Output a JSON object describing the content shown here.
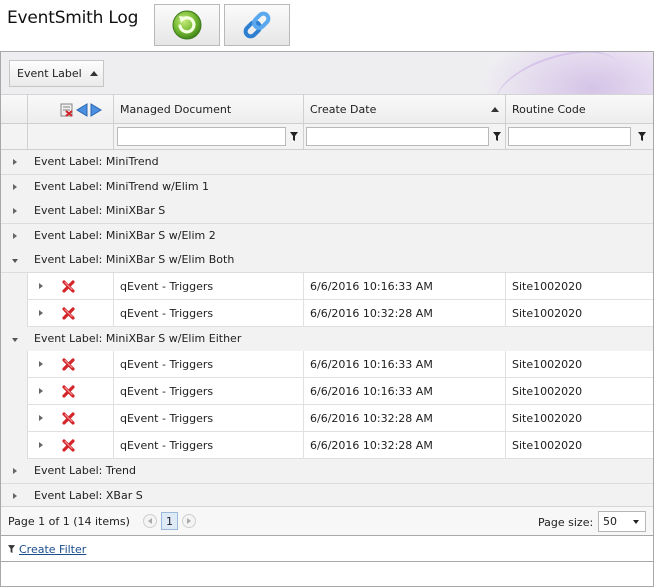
{
  "app": {
    "title": "EventSmith Log"
  },
  "toolbar": {
    "refresh_icon": "refresh-icon",
    "link_icon": "chain-link-icon"
  },
  "group_panel": {
    "chip_label": "Event Label",
    "chip_sort": "ascending"
  },
  "columns": [
    {
      "label": "Managed Document"
    },
    {
      "label": "Create Date",
      "sort": "ascending"
    },
    {
      "label": "Routine Code"
    }
  ],
  "header_icons": [
    "delete-icon",
    "previous-icon",
    "next-icon"
  ],
  "groups": [
    {
      "label": "Event Label: MiniTrend",
      "expanded": false,
      "rows": []
    },
    {
      "label": "Event Label: MiniTrend w/Elim 1",
      "expanded": false,
      "rows": []
    },
    {
      "label": "Event Label: MiniXBar S",
      "expanded": false,
      "rows": []
    },
    {
      "label": "Event Label: MiniXBar S w/Elim 2",
      "expanded": false,
      "rows": []
    },
    {
      "label": "Event Label: MiniXBar S w/Elim Both",
      "expanded": true,
      "rows": [
        {
          "document": "qEvent - Triggers",
          "date": "6/6/2016 10:16:33 AM",
          "routine": "Site1002020"
        },
        {
          "document": "qEvent - Triggers",
          "date": "6/6/2016 10:32:28 AM",
          "routine": "Site1002020"
        }
      ]
    },
    {
      "label": "Event Label: MiniXBar S w/Elim Either",
      "expanded": true,
      "rows": [
        {
          "document": "qEvent - Triggers",
          "date": "6/6/2016 10:16:33 AM",
          "routine": "Site1002020"
        },
        {
          "document": "qEvent - Triggers",
          "date": "6/6/2016 10:16:33 AM",
          "routine": "Site1002020"
        },
        {
          "document": "qEvent - Triggers",
          "date": "6/6/2016 10:32:28 AM",
          "routine": "Site1002020"
        },
        {
          "document": "qEvent - Triggers",
          "date": "6/6/2016 10:32:28 AM",
          "routine": "Site1002020"
        }
      ]
    },
    {
      "label": "Event Label: Trend",
      "expanded": false,
      "rows": []
    },
    {
      "label": "Event Label: XBar S",
      "expanded": false,
      "rows": []
    }
  ],
  "pager": {
    "info": "Page 1 of 1 (14 items)",
    "current_page": "1",
    "page_size_label": "Page size:",
    "page_size": "50"
  },
  "footer": {
    "create_filter": "Create Filter"
  },
  "colors": {
    "link": "#1a4d8c",
    "delete_red": "#d2262b",
    "refresh_green": "#4f9a2a",
    "link_blue": "#3a8fd8",
    "nav_blue": "#4a8fe0"
  }
}
